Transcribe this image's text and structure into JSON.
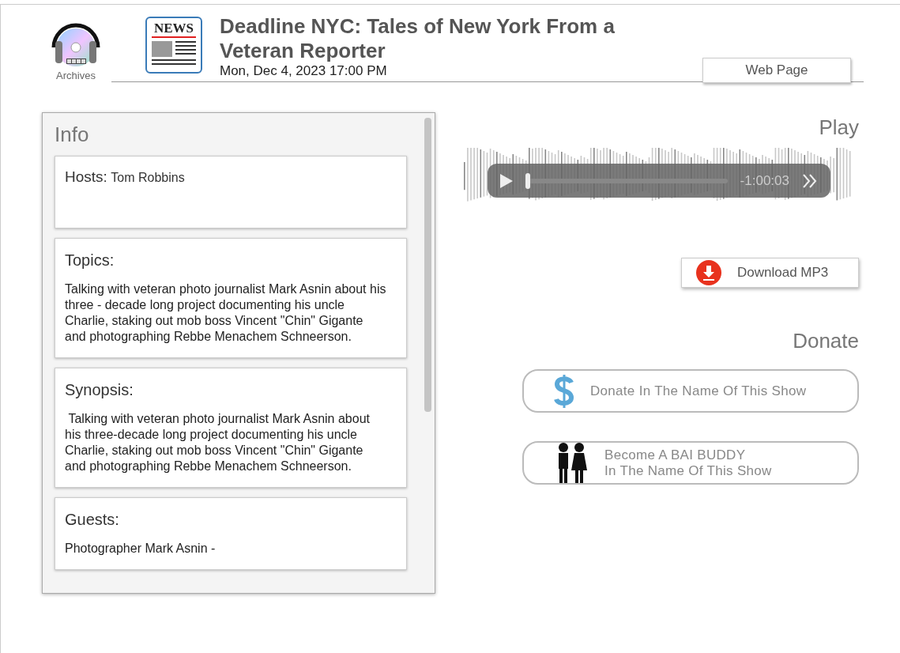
{
  "logo": {
    "caption": "Archives"
  },
  "news_icon": {
    "label": "NEWS"
  },
  "header": {
    "title": "Deadline NYC: Tales of New York From a Veteran Reporter",
    "date": "Mon, Dec 4, 2023 17:00 PM",
    "web_page_button": "Web Page"
  },
  "info": {
    "title": "Info",
    "cards": [
      {
        "label": "Hosts:",
        "text": "Tom Robbins",
        "kind": "inline"
      },
      {
        "label": "Topics:",
        "text": "Talking with veteran photo journalist Mark Asnin about his three - decade long project documenting his uncle Charlie, staking out mob boss Vincent \"Chin\" Gigante and photographing Rebbe Menachem Schneerson.",
        "kind": "block"
      },
      {
        "label": "Synopsis:",
        "text": " Talking with veteran photo journalist Mark Asnin about his three-decade long project documenting his uncle Charlie, staking out mob boss Vincent \"Chin\" Gigante and photographing Rebbe Menachem Schneerson.",
        "kind": "block"
      },
      {
        "label": "Guests:",
        "text": "Photographer Mark Asnin -",
        "kind": "block"
      }
    ]
  },
  "play": {
    "title": "Play",
    "player": {
      "level": 0.0,
      "time": "-1:00:03"
    },
    "download_button": "Download MP3"
  },
  "donate": {
    "title": "Donate",
    "buttons": [
      {
        "kind": "dollar",
        "lines": [
          "Donate In The Name Of This Show"
        ]
      },
      {
        "kind": "buddy",
        "lines": [
          "Become A BAI BUDDY",
          "In The Name Of This Show"
        ]
      }
    ]
  }
}
